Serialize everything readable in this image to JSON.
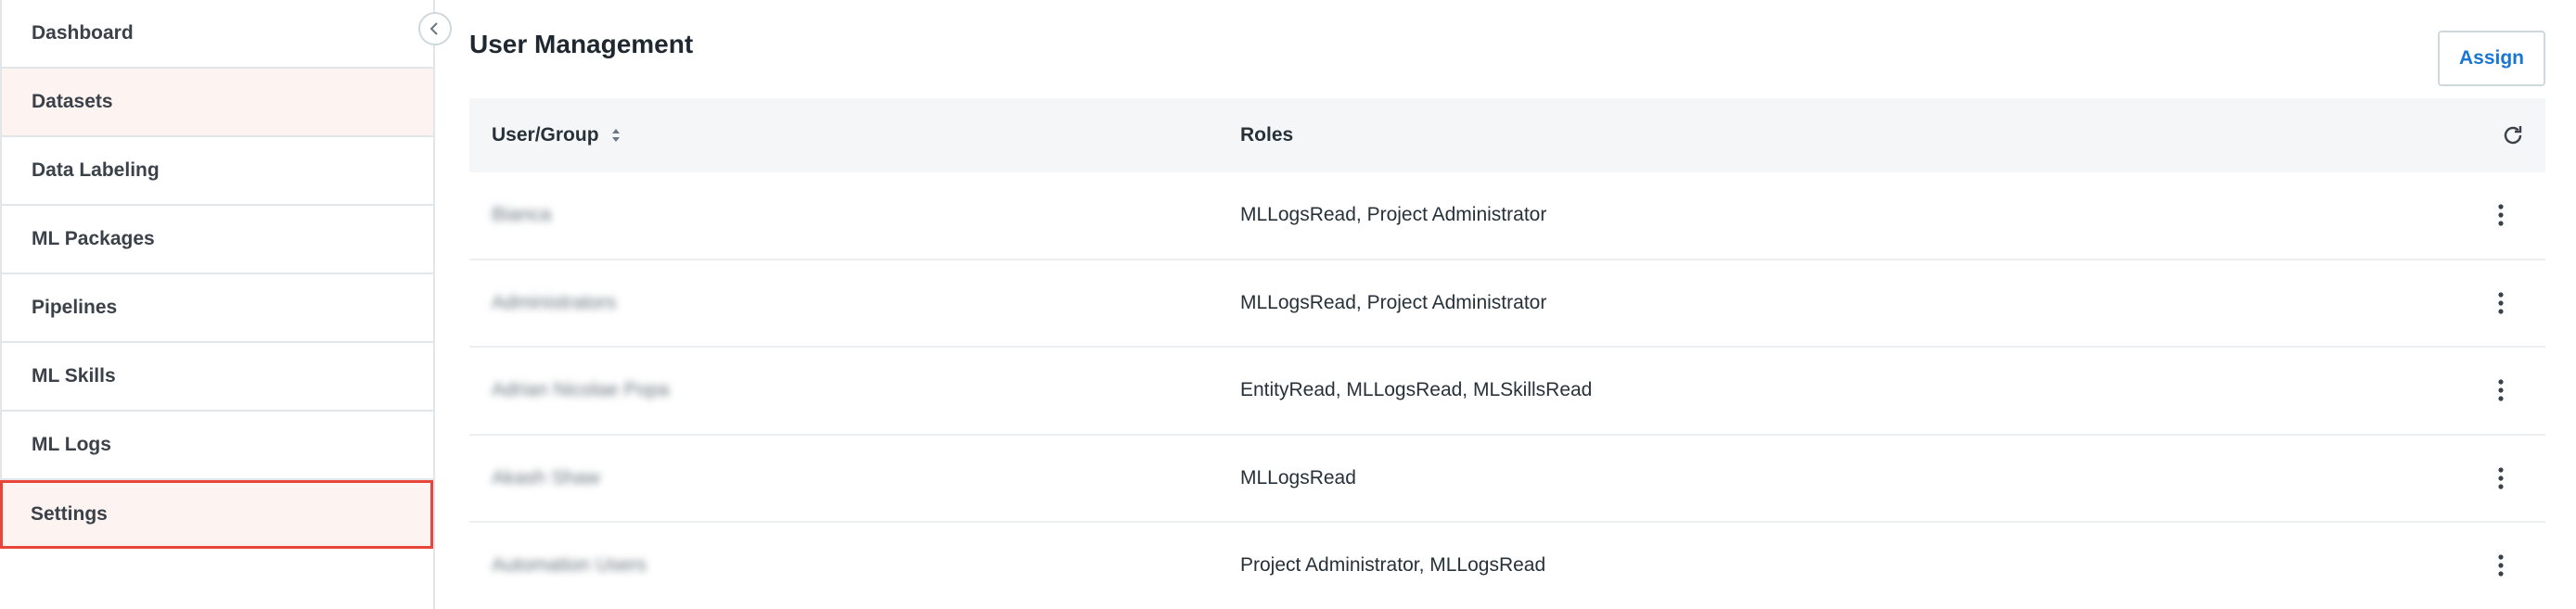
{
  "sidebar": {
    "items": [
      {
        "label": "Dashboard"
      },
      {
        "label": "Datasets"
      },
      {
        "label": "Data Labeling"
      },
      {
        "label": "ML Packages"
      },
      {
        "label": "Pipelines"
      },
      {
        "label": "ML Skills"
      },
      {
        "label": "ML Logs"
      },
      {
        "label": "Settings"
      }
    ],
    "active_item": "Settings",
    "collapse_icon": "chevron-left-icon"
  },
  "main": {
    "title": "User Management",
    "assign_label": "Assign",
    "grid": {
      "columns": [
        {
          "label": "User/Group"
        },
        {
          "label": "Roles"
        }
      ],
      "rows": [
        {
          "user": "Bianca",
          "roles": "MLLogsRead, Project Administrator"
        },
        {
          "user": "Administrators",
          "roles": "MLLogsRead, Project Administrator"
        },
        {
          "user": "Adrian Nicolae Popa",
          "roles": "EntityRead, MLLogsRead, MLSkillsRead"
        },
        {
          "user": "Akash Shaw",
          "roles": "MLLogsRead"
        },
        {
          "user": "Automation Users",
          "roles": "Project Administrator, MLLogsRead"
        }
      ]
    }
  },
  "colors": {
    "accent": "#e8463a",
    "link": "#1976d2",
    "highlight_bg": "#fdf3f1",
    "header_bg": "#f4f6f8"
  }
}
